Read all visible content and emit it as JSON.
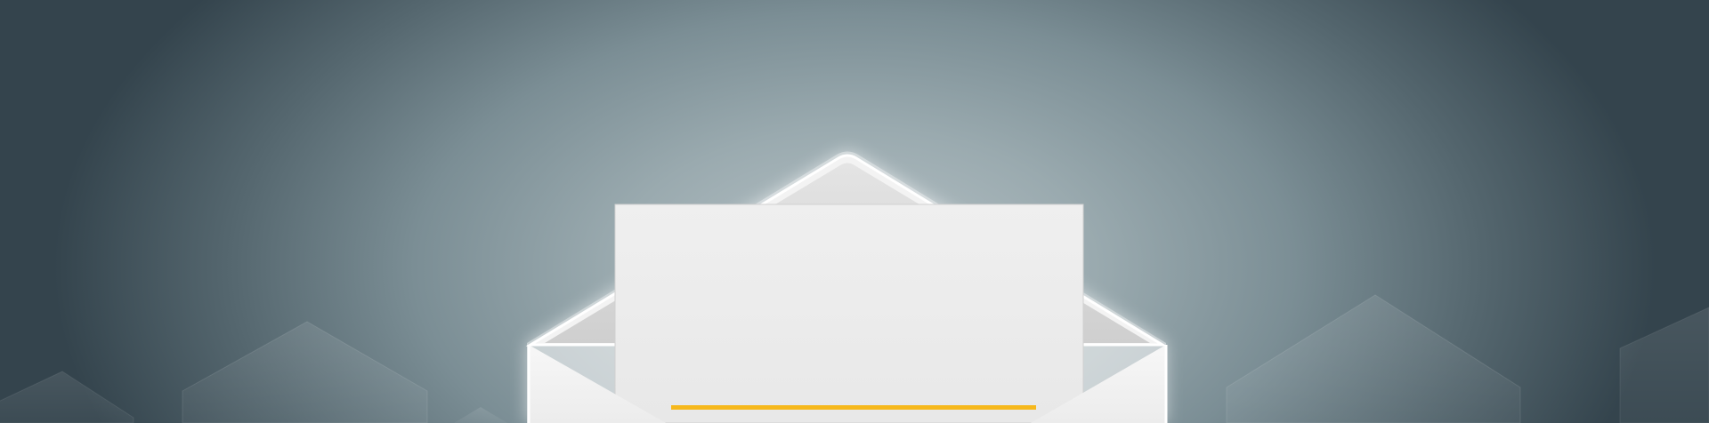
{
  "banner": {
    "background_colors": {
      "center": "#b7c2c6",
      "mid": "#7b8e95",
      "edge": "#34444d"
    },
    "envelope": {
      "body_color": "#f1f1f1",
      "flap_color": "#d8d8d8",
      "letter_color": "#ececec",
      "accent_line_color": "#f6b81c",
      "icon": "open-envelope-icon"
    }
  }
}
